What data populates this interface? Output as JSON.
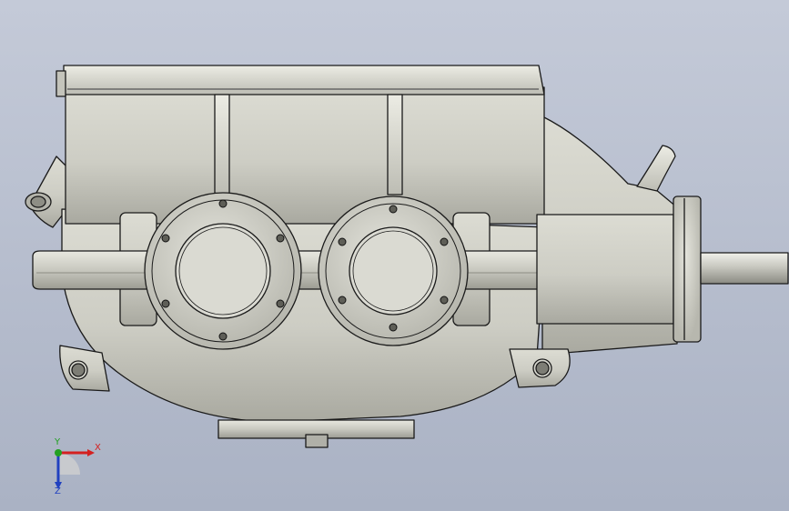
{
  "viewport": {
    "background_top": "#c4cad8",
    "background_bottom": "#aab2c4"
  },
  "model": {
    "body_color": "#cfcfc6",
    "shadow_color": "#8f8f86",
    "edge_color": "#1a1a1a"
  },
  "triad": {
    "x_label": "X",
    "y_label": "Y",
    "z_label": "Z",
    "x_color": "#d42020",
    "y_color": "#22a022",
    "z_color": "#2040c0"
  }
}
